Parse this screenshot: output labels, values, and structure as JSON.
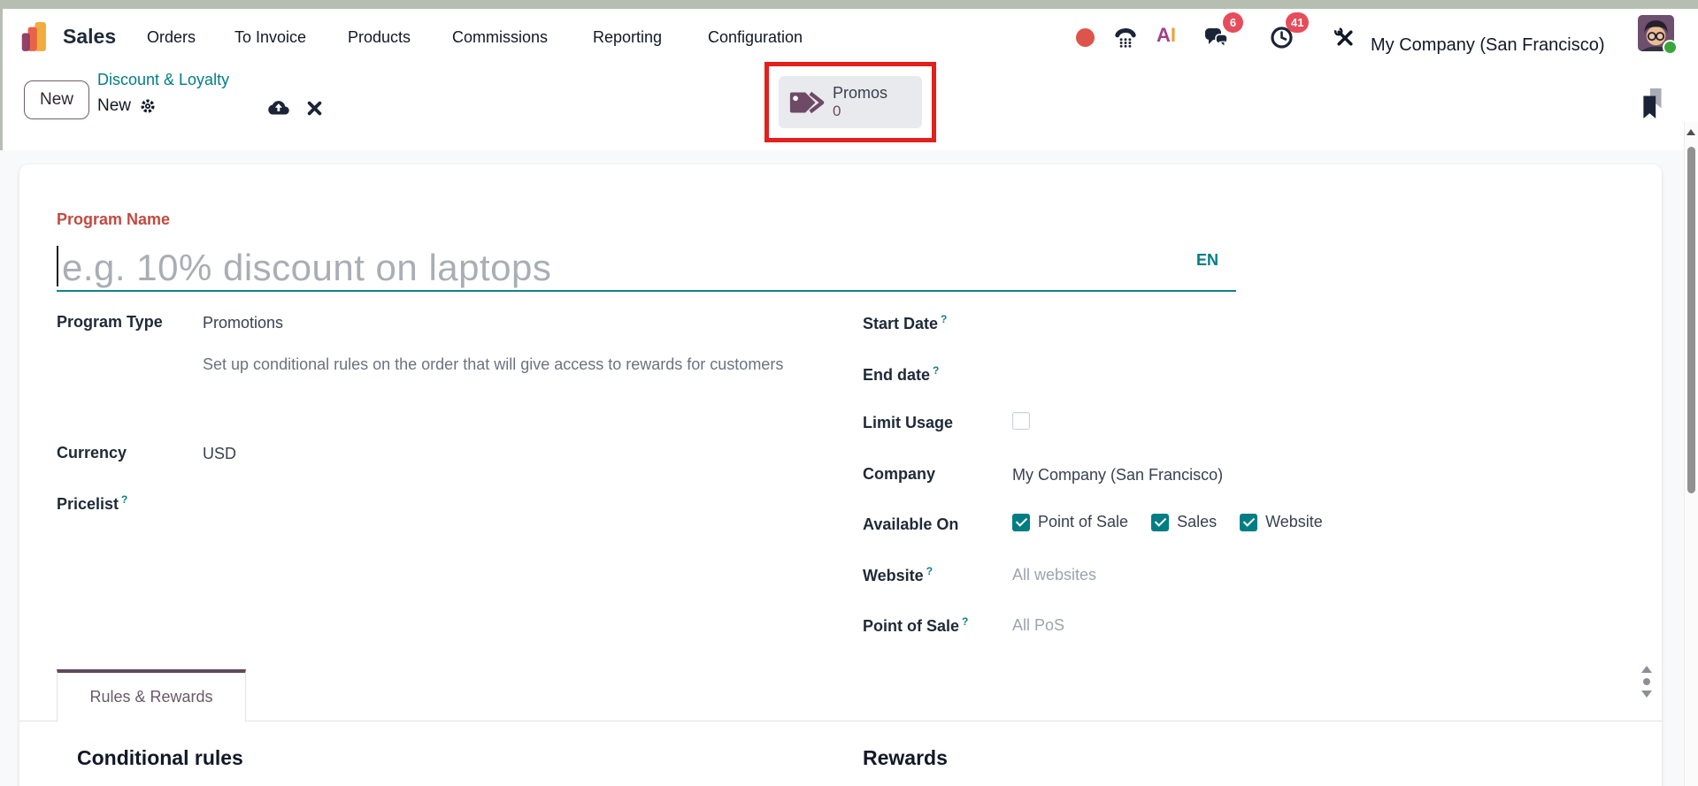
{
  "topnav": {
    "brand": "Sales",
    "items": [
      {
        "label": "Orders"
      },
      {
        "label": "To Invoice"
      },
      {
        "label": "Products"
      },
      {
        "label": "Commissions"
      },
      {
        "label": "Reporting"
      },
      {
        "label": "Configuration"
      }
    ],
    "message_badge": "6",
    "activity_badge": "41",
    "company": "My Company (San Francisco)"
  },
  "control_panel": {
    "new_button": "New",
    "breadcrumb_parent": "Discount & Loyalty",
    "breadcrumb_current": "New",
    "promos_button": {
      "label": "Promos",
      "count": "0"
    }
  },
  "form": {
    "program_name_label": "Program Name",
    "program_name_placeholder": "e.g. 10% discount on laptops",
    "language_code": "EN",
    "program_type_label": "Program Type",
    "program_type_value": "Promotions",
    "program_type_help": "Set up conditional rules on the order that will give access to rewards for customers",
    "currency_label": "Currency",
    "currency_value": "USD",
    "pricelist_label": "Pricelist",
    "start_date_label": "Start Date",
    "end_date_label": "End date",
    "limit_usage_label": "Limit Usage",
    "company_label": "Company",
    "company_value": "My Company (San Francisco)",
    "available_on_label": "Available On",
    "available_options": [
      {
        "label": "Point of Sale",
        "checked": true
      },
      {
        "label": "Sales",
        "checked": true
      },
      {
        "label": "Website",
        "checked": true
      }
    ],
    "website_label": "Website",
    "website_placeholder": "All websites",
    "pos_label": "Point of Sale",
    "pos_placeholder": "All PoS",
    "help_marker": "?"
  },
  "tabs": {
    "rules_rewards": "Rules & Rewards"
  },
  "sections": {
    "conditional_rules": "Conditional rules",
    "rewards": "Rewards"
  },
  "colors": {
    "accent_teal": "#017e84",
    "brand_purple": "#6d4a66",
    "required_red": "#c14a41",
    "annotation_red": "#e3201c",
    "badge_red": "#e74c5b",
    "tab_purple": "#5d4a5e"
  }
}
